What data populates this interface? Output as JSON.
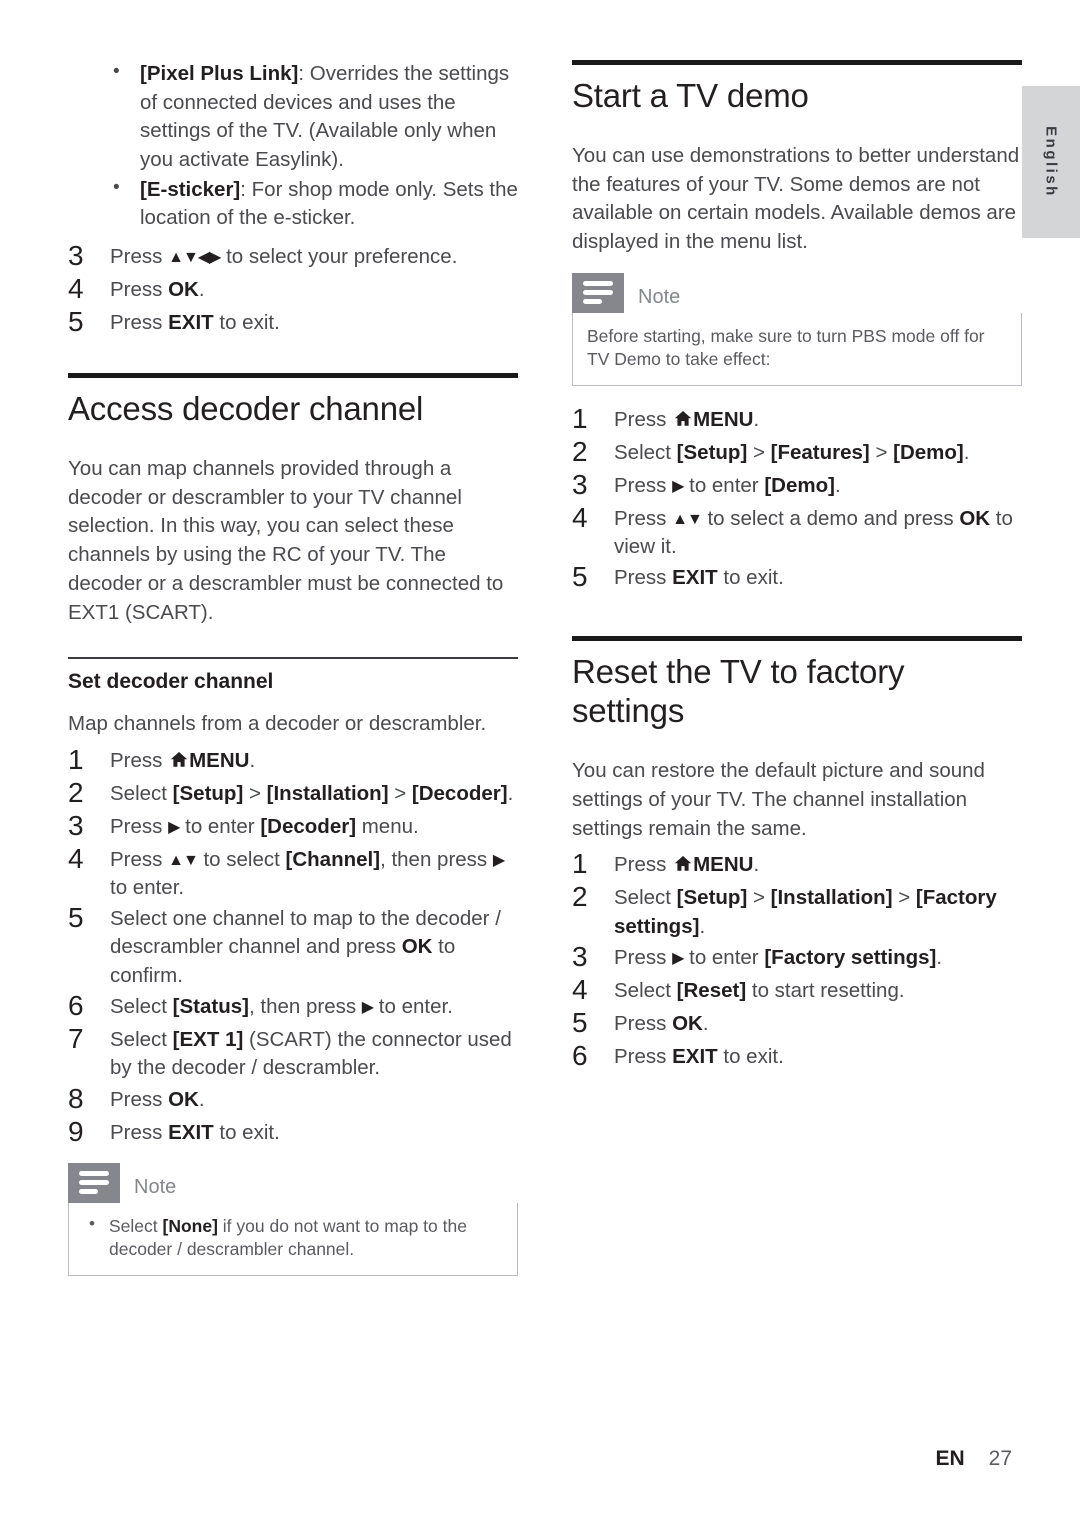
{
  "page": {
    "language_tab": "English",
    "footer": {
      "locale": "EN",
      "page_number": "27"
    }
  },
  "left_column": {
    "continued_bullets": [
      {
        "term": "[Pixel Plus Link]",
        "text": ": Overrides the settings of connected devices and uses the settings of the TV. (Available only when you activate Easylink)."
      },
      {
        "term": "[E-sticker]",
        "text": ": For shop mode only. Sets the location of the e-sticker."
      }
    ],
    "continued_steps": [
      {
        "num": "3",
        "pre": "Press ",
        "icon": "arrows-updownleftright",
        "post": " to select your preference."
      },
      {
        "num": "4",
        "pre": "Press ",
        "bold": "OK",
        "post": "."
      },
      {
        "num": "5",
        "pre": "Press ",
        "bold": "EXIT",
        "post": " to exit."
      }
    ],
    "section": {
      "title": "Access decoder channel",
      "intro": "You can map channels provided through a decoder or descrambler to your TV channel selection. In this way, you can select these channels by using the RC of your TV. The decoder or a descrambler must be connected to EXT1 (SCART).",
      "subsection_title": "Set decoder channel",
      "subsection_intro": "Map channels from a decoder or descrambler.",
      "steps": [
        {
          "num": "1",
          "text_plain": "Press ⌂ MENU."
        },
        {
          "num": "2",
          "text_plain": "Select [Setup] > [Installation] > [Decoder]."
        },
        {
          "num": "3",
          "text_plain": "Press ▶ to enter [Decoder] menu."
        },
        {
          "num": "4",
          "text_plain": "Press ▲▼ to select [Channel], then press ▶ to enter."
        },
        {
          "num": "5",
          "text_plain": "Select one channel to map to the decoder / descrambler channel and press OK to confirm."
        },
        {
          "num": "6",
          "text_plain": "Select [Status], then press ▶ to enter."
        },
        {
          "num": "7",
          "text_plain": "Select [EXT 1] (SCART) the connector used by the decoder / descrambler."
        },
        {
          "num": "8",
          "text_plain": "Press OK."
        },
        {
          "num": "9",
          "text_plain": "Press EXIT to exit."
        }
      ],
      "note": {
        "title": "Note",
        "bullets": [
          "Select [None] if you do not want to map to the decoder / descrambler channel."
        ]
      }
    }
  },
  "right_column": {
    "demo_section": {
      "title": "Start a TV demo",
      "intro": "You can use demonstrations to better understand the features of your TV. Some demos are not available on certain models. Available demos are displayed in the menu list.",
      "note": {
        "title": "Note",
        "text": "Before starting, make sure to turn PBS mode off for TV Demo to take effect:"
      },
      "steps": [
        {
          "num": "1",
          "text_plain": "Press ⌂ MENU."
        },
        {
          "num": "2",
          "text_plain": "Select [Setup] > [Features] > [Demo]."
        },
        {
          "num": "3",
          "text_plain": "Press ▶ to enter [Demo]."
        },
        {
          "num": "4",
          "text_plain": "Press ▲▼ to select a demo and press OK to view it."
        },
        {
          "num": "5",
          "text_plain": "Press EXIT to exit."
        }
      ]
    },
    "reset_section": {
      "title": "Reset the TV to factory settings",
      "intro": "You can restore the default picture and sound settings of your TV. The channel installation settings remain the same.",
      "steps": [
        {
          "num": "1",
          "text_plain": "Press ⌂ MENU."
        },
        {
          "num": "2",
          "text_plain": "Select [Setup] > [Installation] > [Factory settings]."
        },
        {
          "num": "3",
          "text_plain": "Press ▶ to enter [Factory settings]."
        },
        {
          "num": "4",
          "text_plain": "Select [Reset] to start resetting."
        },
        {
          "num": "5",
          "text_plain": "Press OK."
        },
        {
          "num": "6",
          "text_plain": "Press EXIT to exit."
        }
      ]
    }
  },
  "fragments": {
    "press": "Press ",
    "select": "Select ",
    "to_enter": " to enter",
    "to_exit": " to exit.",
    "menu": "MENU",
    "ok": "OK",
    "exit": "EXIT",
    "gt": " > ",
    "period": ".",
    "setup": "[Setup]",
    "installation": "[Installation]",
    "decoder": "[Decoder]",
    "features": "[Features]",
    "demo": "[Demo]",
    "channel": "[Channel]",
    "status": "[Status]",
    "ext1": "[EXT 1]",
    "factory_settings": "[Factory settings]",
    "reset": "[Reset]",
    "none": "[None]",
    "menu_prefix": "Press ",
    "s2_left": "Select ",
    "s3_decoder_tail": " menu.",
    "s4_chan_mid": ", then press ",
    "s4_chan_tail": " to enter.",
    "s5_a": "Select one channel to map to the decoder / descrambler channel and press ",
    "s5_b": " to confirm.",
    "s6_mid": ", then press ",
    "s6_tail": " to enter.",
    "s7_mid": " (SCART) the connector used by the decoder / descrambler.",
    "d4_a": "Press ",
    "d4_b": " to select a demo and press ",
    "d4_c": " to view it.",
    "r4_tail": " to start resetting.",
    "n1_a": "Select ",
    "n1_b": " if you do not want to map to the decoder / descrambler channel.",
    "e3_a": "Press ",
    "e3_b": " to select your preference.",
    "arrow_right": "▶",
    "arrows_ud": "▲▼",
    "arrows_udlr": "▲▼◀▶"
  }
}
